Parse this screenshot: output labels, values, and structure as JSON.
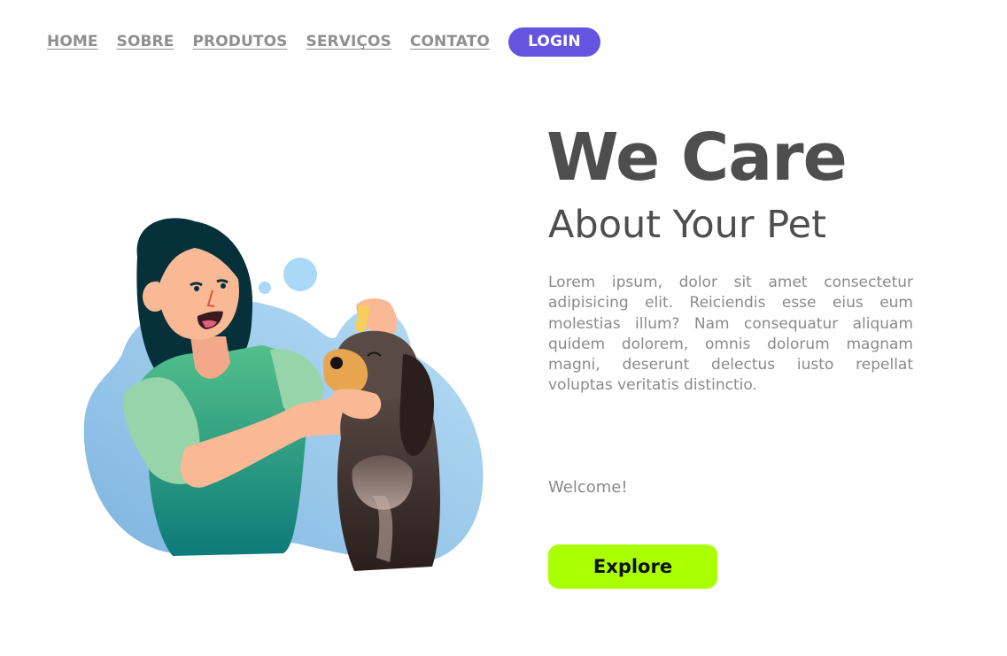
{
  "nav": {
    "items": [
      {
        "label": "HOME"
      },
      {
        "label": "SOBRE"
      },
      {
        "label": "PRODUTOS"
      },
      {
        "label": "SERVIÇOS"
      },
      {
        "label": "CONTATO"
      }
    ],
    "login_label": "LOGIN"
  },
  "hero": {
    "headline": "We Care",
    "subheadline": "About Your Pet",
    "body": "Lorem ipsum, dolor sit amet consectetur adipisicing elit. Reiciendis esse eius eum molestias illum? Nam consequatur aliquam quidem dolorem, omnis dolorum magnam magni, deserunt delectus iusto repellat voluptas veritatis distinctio.",
    "welcome": "Welcome!",
    "cta_label": "Explore"
  },
  "illustration": {
    "subject": "woman-giving-dog-eye-drops",
    "icon": "pet-care-illustration"
  },
  "colors": {
    "nav_text": "#8f8f8f",
    "login_bg": "#6554e0",
    "headline": "#4e4e4e",
    "body_text": "#8a8a8a",
    "cta_bg": "#aaff00",
    "blob": "#8cc6ee"
  }
}
